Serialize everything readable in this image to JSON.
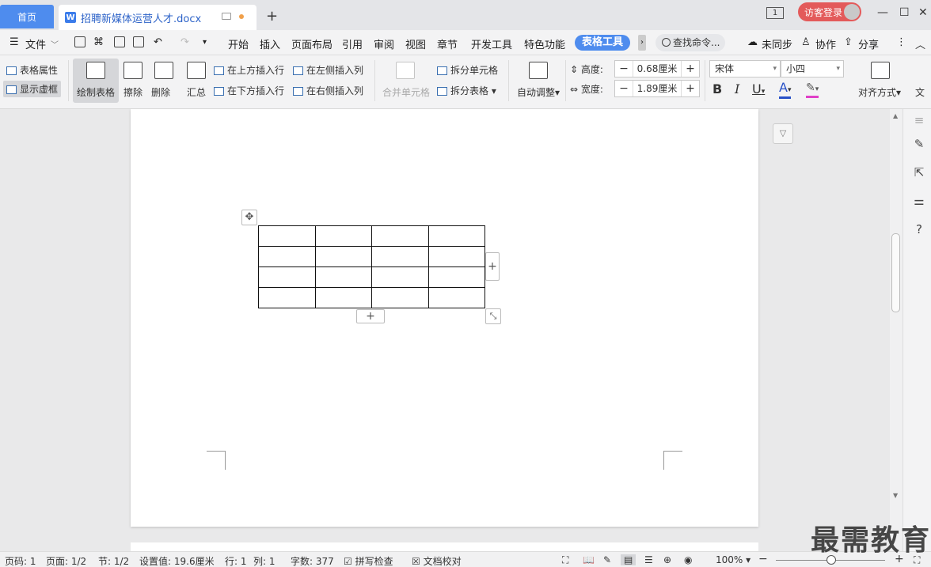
{
  "titlebar": {
    "home_tab": "首页",
    "doc_tab": "招聘新媒体运营人才.docx",
    "new_tab": "+",
    "window_switch": "1",
    "login": "访客登录"
  },
  "menu": {
    "file": "文件",
    "tabs": [
      "开始",
      "插入",
      "页面布局",
      "引用",
      "审阅",
      "视图",
      "章节",
      "开发工具",
      "特色功能"
    ],
    "active_tab": "表格工具",
    "search": "查找命令...",
    "sync": "未同步",
    "collab": "协作",
    "share": "分享"
  },
  "ribbon": {
    "table_props": "表格属性",
    "show_grid": "显示虚框",
    "draw_table": "绘制表格",
    "erase": "擦除",
    "delete": "删除",
    "summary": "汇总",
    "insert_above": "在上方插入行",
    "insert_below": "在下方插入行",
    "insert_left": "在左侧插入列",
    "insert_right": "在右侧插入列",
    "merge_cells": "合并单元格",
    "split_cells": "拆分单元格",
    "split_table": "拆分表格",
    "auto_adjust": "自动调整",
    "height_label": "高度:",
    "height_value": "0.68厘米",
    "width_label": "宽度:",
    "width_value": "1.89厘米",
    "font_name": "宋体",
    "font_size": "小四",
    "bold": "B",
    "italic": "I",
    "underline": "U",
    "font_color": "A",
    "align": "对齐方式",
    "text_dir": "文"
  },
  "table": {
    "rows": 4,
    "cols": 4
  },
  "status": {
    "page_code": "页码: 1",
    "page": "页面: 1/2",
    "section": "节: 1/2",
    "setting": "设置值: 19.6厘米",
    "row": "行: 1",
    "col": "列: 1",
    "words": "字数: 377",
    "spell": "拼写检查",
    "proof": "文档校对",
    "zoom": "100%"
  },
  "watermark": "最需教育",
  "colors": {
    "accent": "#4e8cee",
    "login": "#e35a5a"
  }
}
